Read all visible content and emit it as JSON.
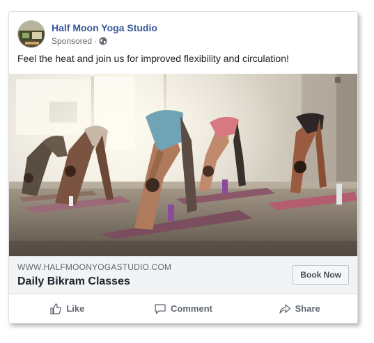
{
  "post": {
    "page_name": "Half Moon Yoga Studio",
    "sponsored_label": "Sponsored",
    "separator": "·",
    "audience_icon": "globe-icon",
    "text": "Feel the heat and join us for improved flexibility and circulation!"
  },
  "link_preview": {
    "domain": "WWW.HALFMOONYOGASTUDIO.COM",
    "headline": "Daily Bikram Classes",
    "cta_label": "Book Now"
  },
  "actions": [
    {
      "label": "Like",
      "icon": "thumbs-up-icon"
    },
    {
      "label": "Comment",
      "icon": "comment-icon"
    },
    {
      "label": "Share",
      "icon": "share-icon"
    }
  ],
  "colors": {
    "page_name": "#385898",
    "secondary_text": "#616770",
    "link_area_bg": "#f2f3f5",
    "border": "#dddfe2"
  }
}
